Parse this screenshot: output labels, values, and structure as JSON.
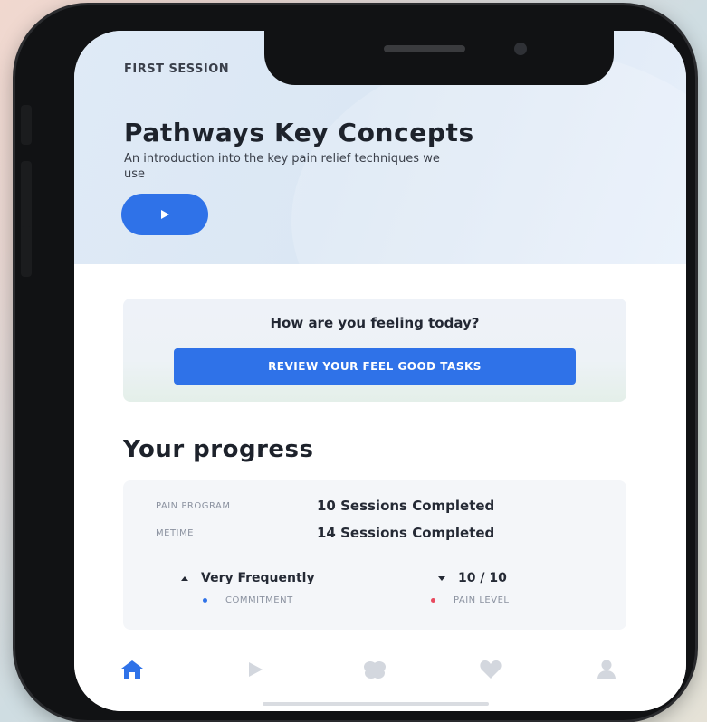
{
  "hero": {
    "eyebrow": "FIRST SESSION",
    "title": "Pathways Key Concepts",
    "subtitle": "An introduction into the key pain relief techniques we use",
    "play_icon": "play-icon"
  },
  "feeling": {
    "question": "How are you feeling today?",
    "button_label": "REVIEW YOUR FEEL GOOD TASKS"
  },
  "progress": {
    "heading": "Your progress",
    "rows": [
      {
        "label": "PAIN PROGRAM",
        "value": "10 Sessions Completed"
      },
      {
        "label": "METIME",
        "value": "14 Sessions Completed"
      }
    ],
    "stats": [
      {
        "value": "Very Frequently",
        "label": "COMMITMENT",
        "trend": "up",
        "dot_color": "#2f72e8"
      },
      {
        "value": "10 / 10",
        "label": "PAIN LEVEL",
        "trend": "down",
        "dot_color": "#e84a5f"
      }
    ]
  },
  "tabbar": {
    "tabs": [
      "home-icon",
      "play-icon",
      "brain-icon",
      "heart-icon",
      "profile-icon"
    ],
    "active": "home-icon",
    "active_color": "#2f72e8",
    "inactive_color": "#d3d7de"
  },
  "colors": {
    "accent": "#2f72e8",
    "hero_bg": "#dfeaf6"
  }
}
